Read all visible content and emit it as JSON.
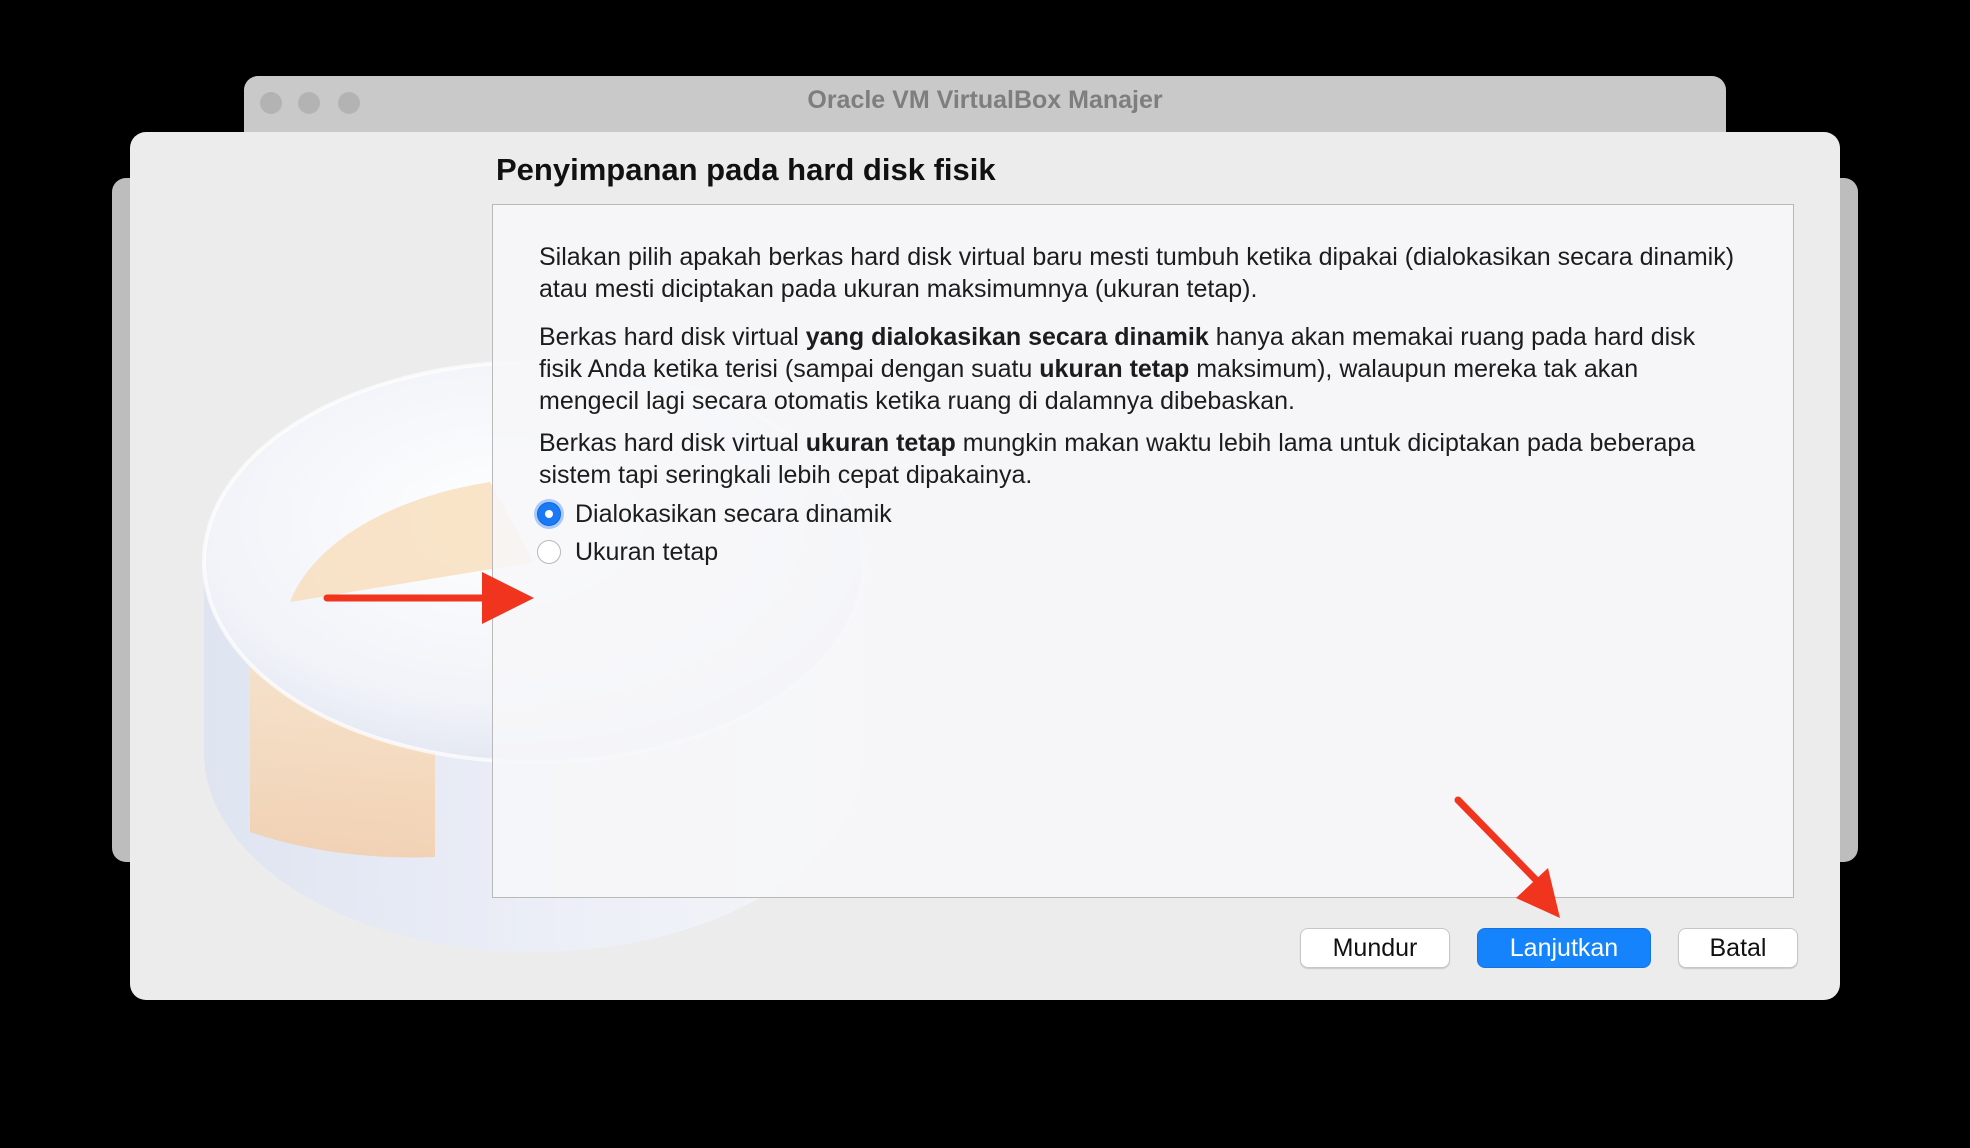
{
  "window": {
    "title": "Oracle VM VirtualBox Manajer",
    "traffic_lights": [
      "close",
      "minimize",
      "zoom"
    ]
  },
  "dialog": {
    "title": "Penyimpanan pada hard disk fisik",
    "paragraph1": "Silakan pilih apakah berkas hard disk virtual baru mesti tumbuh ketika dipakai (dialokasikan secara dinamik) atau mesti diciptakan pada ukuran maksimumnya (ukuran tetap).",
    "paragraph2": {
      "t1": "Berkas hard disk virtual ",
      "b1": "yang dialokasikan secara dinamik",
      "t2": " hanya akan memakai ruang pada hard disk fisik Anda ketika terisi (sampai dengan suatu ",
      "b2": "ukuran tetap",
      "t3": " maksimum), walaupun mereka tak akan mengecil lagi secara otomatis ketika ruang di dalamnya dibebaskan."
    },
    "paragraph3": {
      "t1": "Berkas hard disk virtual ",
      "b1": "ukuran tetap",
      "t2": " mungkin makan waktu lebih lama untuk diciptakan pada beberapa sistem tapi seringkali lebih cepat dipakainya."
    },
    "options": [
      {
        "label": "Dialokasikan secara dinamik",
        "selected": true
      },
      {
        "label": "Ukuran tetap",
        "selected": false
      }
    ],
    "buttons": {
      "back": "Mundur",
      "next": "Lanjutkan",
      "cancel": "Batal"
    }
  },
  "colors": {
    "accent": "#1584fc",
    "annotation_arrow": "#f0341e",
    "backdrop": "#000000"
  }
}
